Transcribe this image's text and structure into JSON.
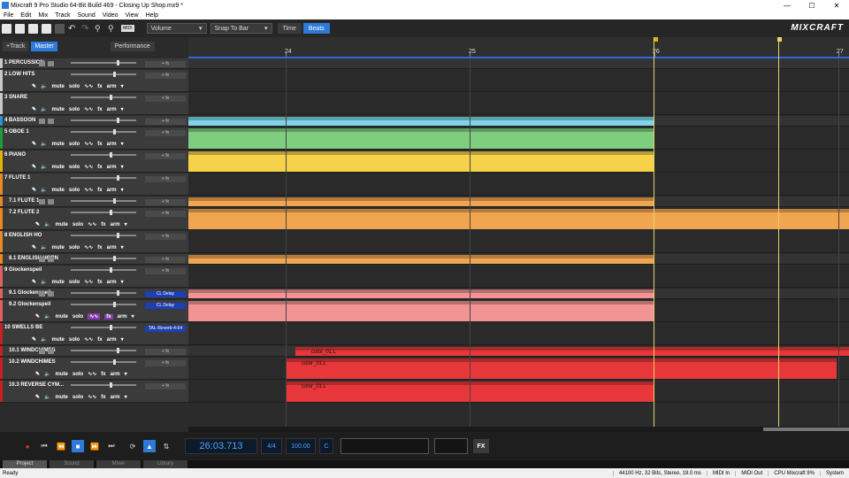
{
  "titlebar": {
    "title": "Mixcraft 9 Pro Studio 64-Bit Build 469 - Closing Up Shop.mx9 *",
    "min": "—",
    "max": "☐",
    "close": "✕"
  },
  "menu": [
    "File",
    "Edit",
    "Mix",
    "Track",
    "Sound",
    "Video",
    "View",
    "Help"
  ],
  "toolbar": {
    "volume_select": "Volume",
    "snap_select": "Snap To Bar",
    "time_label": "Time",
    "beats_label": "Beats",
    "logo": "MIXCRAFT",
    "midi_label": "MIDI"
  },
  "header": {
    "add_track": "+Track",
    "master": "Master",
    "performance": "Performance"
  },
  "ruler": {
    "ticks": [
      "24",
      "25",
      "26",
      "27"
    ]
  },
  "fx_label": "+ fx",
  "controls": {
    "mute": "mute",
    "solo": "solo",
    "fx": "fx",
    "arm": "arm"
  },
  "tracks": [
    {
      "name": "1 PERCUSSION",
      "color": "#c8c8c8",
      "fx": "+ fx"
    },
    {
      "name": "2 LOW HITS",
      "color": "#c8c8c8",
      "fx": "+ fx"
    },
    {
      "name": "3 SNARE",
      "color": "#c8c8c8",
      "fx": "+ fx"
    },
    {
      "name": "4 BASSOON",
      "color": "#2a8fd4",
      "fx": "+ fx"
    },
    {
      "name": "5 OBOE 1",
      "color": "#1e9a3c",
      "fx": "+ fx"
    },
    {
      "name": "6 PIANO",
      "color": "#e0b400",
      "fx": "+ fx"
    },
    {
      "name": "7 FLUTE 1",
      "color": "#e88a20",
      "fx": "+ fx"
    },
    {
      "name": "7.1 FLUTE 1",
      "color": "#e88a20",
      "fx": "+ fx"
    },
    {
      "name": "7.2 FLUTE 2",
      "color": "#e88a20",
      "fx": "+ fx"
    },
    {
      "name": "8 ENGLISH HO",
      "color": "#e88a20",
      "fx": "+ fx"
    },
    {
      "name": "8.1 ENGLISH HORN",
      "color": "#e88a20",
      "fx": "+ fx"
    },
    {
      "name": "9 Glockenspeil",
      "color": "#e06060",
      "fx": "+ fx"
    },
    {
      "name": "9.1 Glockenspeil",
      "color": "#e06060",
      "fx": "CL Delay"
    },
    {
      "name": "9.2 Glockenspeil",
      "color": "#e06060",
      "fx": "CL Delay"
    },
    {
      "name": "10 SWELLS BE",
      "color": "#cc2020",
      "fx": "TAL-Reverb-4-64"
    },
    {
      "name": "10.1 WINDCHIMES",
      "color": "#cc2020",
      "fx": "+ fx"
    },
    {
      "name": "10.2 WINDCHIMES",
      "color": "#cc2020",
      "fx": "+ fx"
    },
    {
      "name": "10.3 REVERSE CYM...",
      "color": "#cc2020",
      "fx": "+ fx"
    }
  ],
  "clips": [
    {
      "label": "color_01.L"
    },
    {
      "label": "color_01.L"
    },
    {
      "label": "color_01.L"
    }
  ],
  "transport": {
    "time": "26:03.713",
    "signature": "4/4",
    "tempo": "100.00",
    "key": "C",
    "fx": "FX"
  },
  "tabs": [
    "Project",
    "Sound",
    "Mixer",
    "Library"
  ],
  "status": {
    "left": "Ready",
    "format": "44100 Hz, 32 Bits, Stereo, 19.0 ms",
    "midi_in": "MIDI In",
    "midi_out": "MIDI Out",
    "cpu": "CPU Mixcraft 9%",
    "system": "System"
  },
  "colors": {
    "accent": "#2d7ad8",
    "playhead": "#e8d36a",
    "bassoon": "#7fd4e8",
    "oboe": "#7fce7f",
    "piano": "#f5d24a",
    "flute": "#f0a550",
    "glock": "#f29494",
    "windchimes": "#e8373a"
  }
}
